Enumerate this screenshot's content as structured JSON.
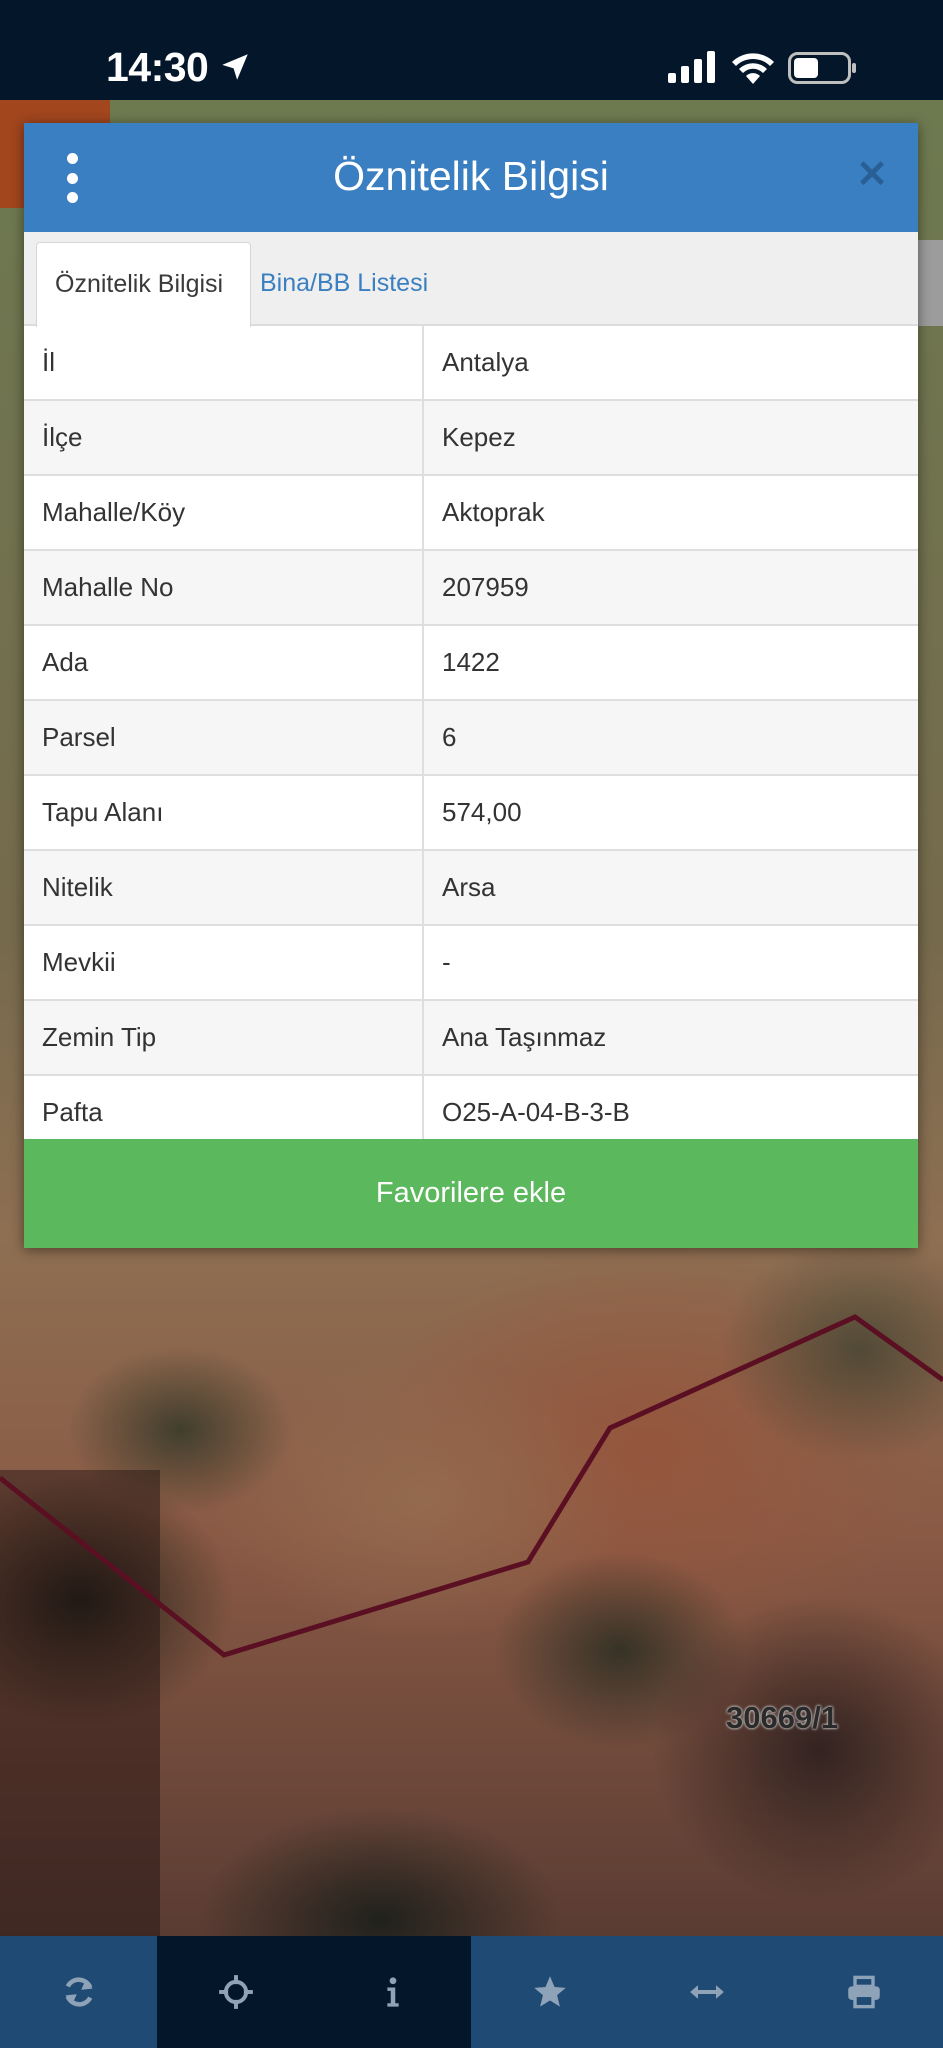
{
  "status_bar": {
    "time": "14:30",
    "icons": [
      "location-arrow-icon",
      "cellular-signal-icon",
      "wifi-icon",
      "battery-icon"
    ]
  },
  "map": {
    "parcel_label": "30669/1",
    "boundary_color": "#5a0f22"
  },
  "modal": {
    "title": "Öznitelik Bilgisi",
    "menu_icon": "vertical-dots-icon",
    "close_icon": "close-icon",
    "tabs": [
      {
        "label": "Öznitelik Bilgisi",
        "active": true
      },
      {
        "label": "Bina/BB Listesi",
        "active": false
      }
    ],
    "rows": [
      {
        "key": "İl",
        "value": "Antalya"
      },
      {
        "key": "İlçe",
        "value": "Kepez"
      },
      {
        "key": "Mahalle/Köy",
        "value": "Aktoprak"
      },
      {
        "key": "Mahalle No",
        "value": "207959"
      },
      {
        "key": "Ada",
        "value": "1422"
      },
      {
        "key": "Parsel",
        "value": "6"
      },
      {
        "key": "Tapu Alanı",
        "value": "574,00"
      },
      {
        "key": "Nitelik",
        "value": "Arsa"
      },
      {
        "key": "Mevkii",
        "value": "-"
      },
      {
        "key": "Zemin Tip",
        "value": "Ana Taşınmaz"
      },
      {
        "key": "Pafta",
        "value": "O25-A-04-B-3-B"
      }
    ],
    "favorite_button_label": "Favorilere ekle"
  },
  "toolbar": {
    "buttons": [
      {
        "icon": "refresh-icon"
      },
      {
        "icon": "crosshair-icon"
      },
      {
        "icon": "info-icon"
      },
      {
        "icon": "star-icon"
      },
      {
        "icon": "measure-arrows-icon"
      },
      {
        "icon": "print-icon"
      }
    ]
  },
  "colors": {
    "header_blue": "#3a7fc1",
    "button_green": "#5cb85c",
    "toolbar_blue": "#1f4a74",
    "toolbar_dark": "#04162a"
  }
}
